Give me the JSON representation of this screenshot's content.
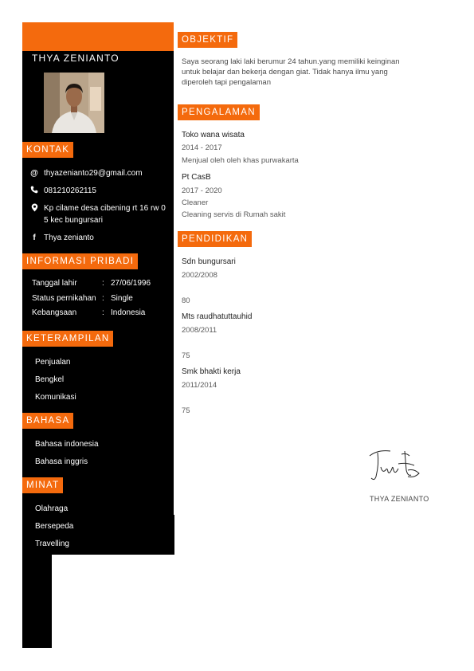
{
  "name": "THYA ZENIANTO",
  "contact": {
    "heading": "KONTAK",
    "email": "thyazenianto29@gmail.com",
    "phone": "081210262115",
    "address_line1": "Kp cilame desa cibening rt 16 rw 0",
    "address_line2": "5 kec bungursari",
    "facebook": "Thya zenianto"
  },
  "personal": {
    "heading": "INFORMASI PRIBADI",
    "rows": [
      {
        "label": "Tanggal lahir",
        "sep": ":",
        "value": "27/06/1996"
      },
      {
        "label": "Status pernikahan",
        "sep": ":",
        "value": "Single"
      },
      {
        "label": "Kebangsaan",
        "sep": ":",
        "value": "Indonesia"
      }
    ]
  },
  "skills": {
    "heading": "KETERAMPILAN",
    "items": [
      "Penjualan",
      "Bengkel",
      "Komunikasi"
    ]
  },
  "languages": {
    "heading": "BAHASA",
    "items": [
      "Bahasa indonesia",
      "Bahasa inggris"
    ]
  },
  "interests": {
    "heading": "MINAT",
    "items": [
      "Olahraga",
      "Bersepeda",
      "Travelling"
    ]
  },
  "objective": {
    "heading": "OBJEKTIF",
    "lines": [
      "Saya seorang laki laki berumur 24 tahun.yang memiliki keinginan",
      "untuk belajar dan bekerja dengan giat. Tidak hanya ilmu yang",
      "diperoleh tapi pengalaman"
    ]
  },
  "experience": {
    "heading": "PENGALAMAN",
    "items": [
      {
        "company": "Toko wana wisata",
        "period": "2014 - 2017",
        "role": "",
        "desc": "Menjual oleh oleh khas purwakarta"
      },
      {
        "company": "Pt CasB",
        "period": "2017 - 2020",
        "role": "Cleaner",
        "desc": "Cleaning servis di Rumah sakit"
      }
    ]
  },
  "education": {
    "heading": "PENDIDIKAN",
    "items": [
      {
        "school": "Sdn bungursari",
        "period": "2002/2008",
        "score": "80"
      },
      {
        "school": "Mts raudhatuttauhid",
        "period": "2008/2011",
        "score": "75"
      },
      {
        "school": "Smk bhakti kerja",
        "period": "2011/2014",
        "score": "75"
      }
    ]
  },
  "signature": {
    "name": "THYA ZENIANTO"
  },
  "colors": {
    "accent": "#f46a0d",
    "sidebar": "#000000"
  }
}
